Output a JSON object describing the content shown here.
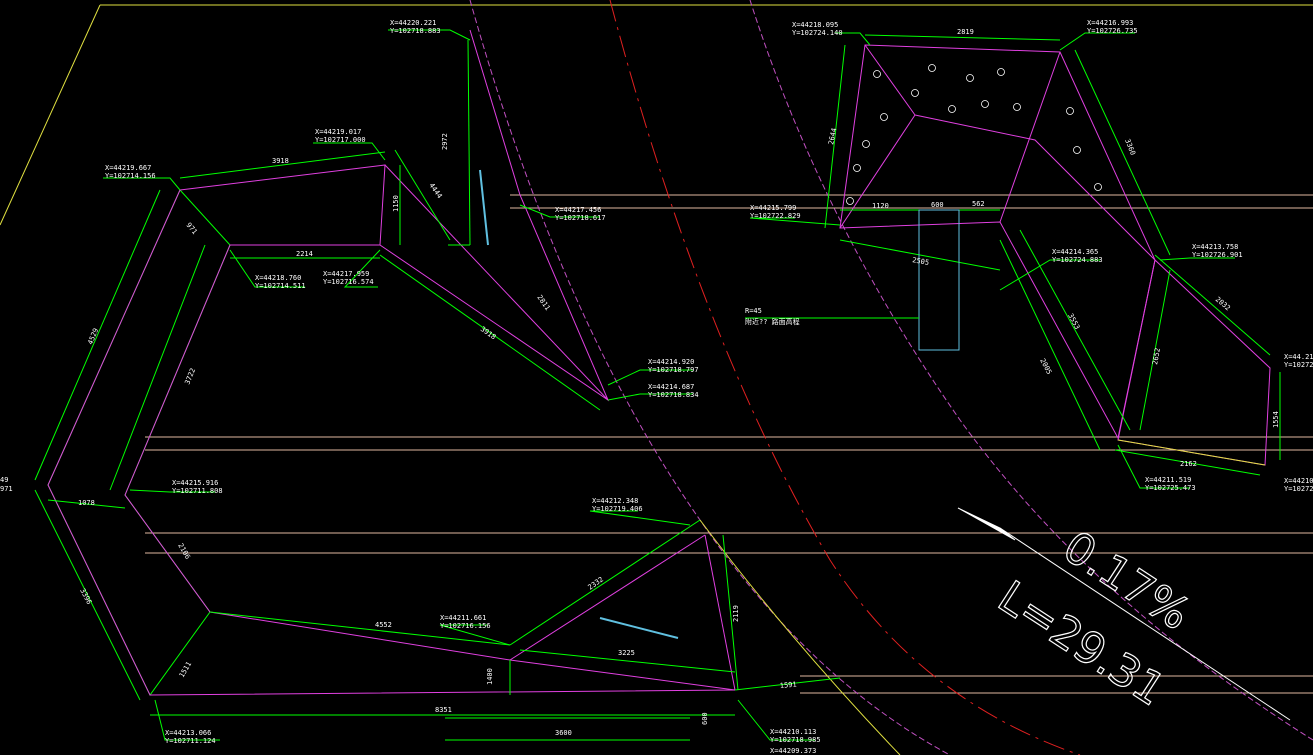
{
  "colors": {
    "background": "#000000",
    "outline_green": "#00ff00",
    "polygon_magenta": "#e040e0",
    "road_edge_magenta": "#c050c0",
    "centerline_red": "#e02020",
    "lane_beige": "#e0b8a0",
    "yellow_line": "#e0e040",
    "cyan_block": "#60c0e0",
    "white": "#ffffff"
  },
  "coordinate_labels": [
    {
      "x": "X=44220.221",
      "y": "Y=102718.883"
    },
    {
      "x": "X=44219.017",
      "y": "Y=102717.000"
    },
    {
      "x": "X=44219.667",
      "y": "Y=102714.156"
    },
    {
      "x": "X=44217.456",
      "y": "Y=102718.617"
    },
    {
      "x": "X=44218.760",
      "y": "Y=102714.511"
    },
    {
      "x": "X=44217.959",
      "y": "Y=102716.574"
    },
    {
      "x": "X=44214.920",
      "y": "Y=102718.797"
    },
    {
      "x": "X=44214.687",
      "y": "Y=102718.834"
    },
    {
      "x": "X=44215.916",
      "y": "Y=102711.808"
    },
    {
      "x": "X=44212.348",
      "y": "Y=102719.406"
    },
    {
      "x": "X=44211.661",
      "y": "Y=102716.156"
    },
    {
      "x": "X=44213.066",
      "y": "Y=102711.124"
    },
    {
      "x": "X=44210.113",
      "y": "Y=102718.985"
    },
    {
      "x": "X=44218.095",
      "y": "Y=102724.140"
    },
    {
      "x": "X=44216.993",
      "y": "Y=102726.735"
    },
    {
      "x": "X=44215.799",
      "y": "Y=102722.829"
    },
    {
      "x": "X=44214.365",
      "y": "Y=102724.883"
    },
    {
      "x": "X=44213.758",
      "y": "Y=102726.901"
    },
    {
      "x": "X=44211.519",
      "y": "Y=102725.473"
    }
  ],
  "partial_labels": [
    "49",
    "971",
    "X=44.21",
    "Y=10272",
    "X=44210",
    "Y=10272",
    "X=44209.373"
  ],
  "dimensions": [
    "2972",
    "3918",
    "1150",
    "4444",
    "2214",
    "971",
    "4529",
    "3722",
    "1078",
    "2106",
    "3396",
    "1511",
    "4552",
    "2332",
    "3225",
    "1400",
    "2119",
    "8351",
    "3600",
    "600",
    "1591",
    "2811",
    "3918",
    "2819",
    "2644",
    "3360",
    "1120",
    "600",
    "562",
    "2505",
    "3553",
    "2005",
    "2032",
    "2652",
    "1554",
    "2162"
  ],
  "annotation": {
    "line1": "R=45",
    "line2": "附近?? 路面高程"
  },
  "slope": {
    "grade": "0.17%",
    "length": "L=29.31"
  }
}
